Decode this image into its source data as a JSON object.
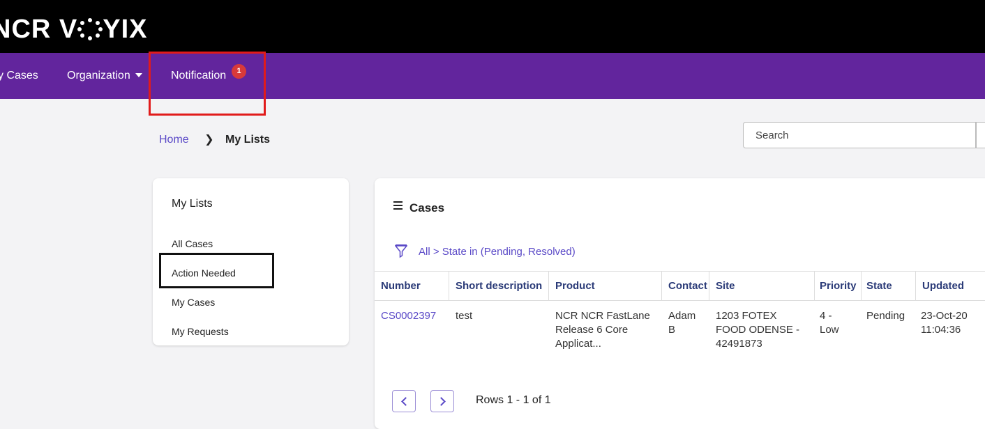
{
  "brand": {
    "logo_text": "NCR VOYIX"
  },
  "nav": {
    "items": [
      {
        "label": "y Cases"
      },
      {
        "label": "Organization"
      },
      {
        "label": "Notification"
      }
    ],
    "notification_badge": "1"
  },
  "breadcrumb": {
    "home": "Home",
    "current": "My Lists"
  },
  "search": {
    "placeholder": "Search"
  },
  "sidebar": {
    "title": "My Lists",
    "items": [
      {
        "label": "All Cases"
      },
      {
        "label": "Action Needed"
      },
      {
        "label": "My Cases"
      },
      {
        "label": "My Requests"
      }
    ]
  },
  "cases": {
    "title": "Cases",
    "filter": "All > State in (Pending, Resolved)",
    "columns": [
      "Number",
      "Short description",
      "Product",
      "Contact",
      "Site",
      "Priority",
      "State",
      "Updated"
    ],
    "rows": [
      {
        "number": "CS0002397",
        "short_description": "test",
        "product": "NCR NCR FastLane Release 6 Core Applicat...",
        "contact": "Adam B",
        "site": "1203 FOTEX FOOD ODENSE - 42491873",
        "priority": "4 - Low",
        "state": "Pending",
        "updated": "23-Oct-20 11:04:36"
      }
    ],
    "rows_text": "Rows 1 - 1 of 1"
  },
  "colors": {
    "nav_bg": "#62259d",
    "topbar_bg": "#000000",
    "link": "#5a49c7",
    "badge": "#d83a3a"
  }
}
